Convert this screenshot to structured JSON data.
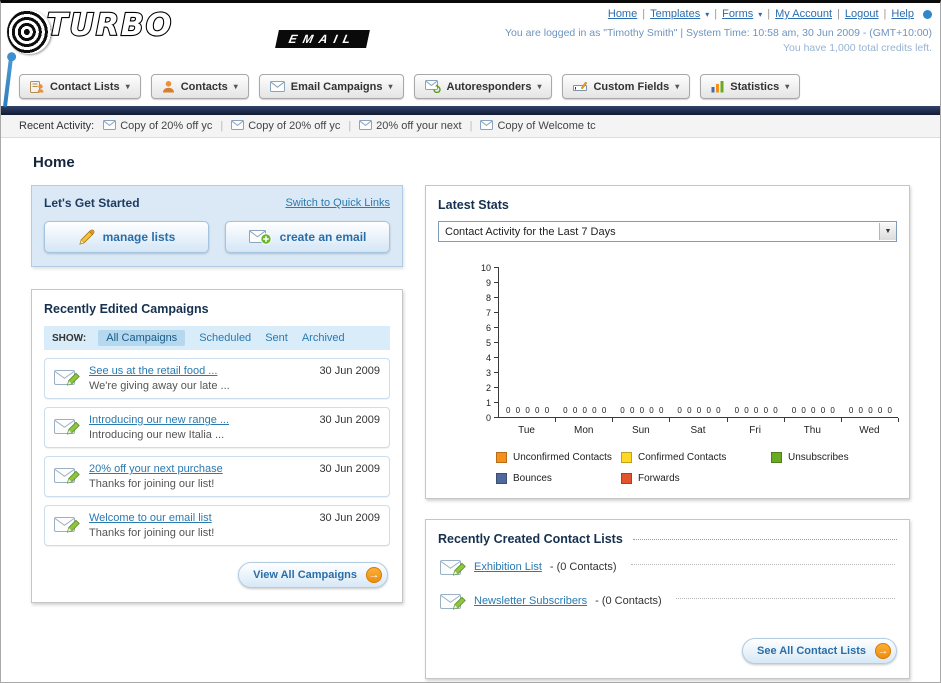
{
  "header": {
    "logo_line1": "TURBO",
    "logo_line2": "EMAIL",
    "links": [
      {
        "label": "Home",
        "dropdown": false
      },
      {
        "label": "Templates",
        "dropdown": true
      },
      {
        "label": "Forms",
        "dropdown": true
      },
      {
        "label": "My Account",
        "dropdown": false
      },
      {
        "label": "Logout",
        "dropdown": false
      },
      {
        "label": "Help",
        "dropdown": false
      }
    ],
    "login_info": "You are logged in as \"Timothy Smith\" | System Time: 10:58 am, 30 Jun 2009 - (GMT+10:00)",
    "credits_info": "You have 1,000 total credits left."
  },
  "nav": {
    "tabs": [
      {
        "label": "Contact Lists",
        "icon": "contact-lists-icon"
      },
      {
        "label": "Contacts",
        "icon": "contacts-icon"
      },
      {
        "label": "Email Campaigns",
        "icon": "email-campaigns-icon"
      },
      {
        "label": "Autoresponders",
        "icon": "autoresponders-icon"
      },
      {
        "label": "Custom Fields",
        "icon": "custom-fields-icon"
      },
      {
        "label": "Statistics",
        "icon": "statistics-icon"
      }
    ]
  },
  "activity": {
    "label": "Recent Activity:",
    "items": [
      "Copy of 20% off yc",
      "Copy of 20% off yc",
      "20% off your next",
      "Copy of Welcome tc"
    ]
  },
  "page_title": "Home",
  "get_started": {
    "title": "Let's Get Started",
    "switch_link": "Switch to Quick Links",
    "manage_lists_btn": "manage lists",
    "create_email_btn": "create an email"
  },
  "campaigns": {
    "title": "Recently Edited Campaigns",
    "show_label": "SHOW:",
    "tabs": [
      {
        "label": "All Campaigns",
        "selected": true
      },
      {
        "label": "Scheduled",
        "selected": false
      },
      {
        "label": "Sent",
        "selected": false
      },
      {
        "label": "Archived",
        "selected": false
      }
    ],
    "rows": [
      {
        "title": "See us at the retail food ...",
        "subtitle": "We're giving away our late ...",
        "date": "30 Jun 2009"
      },
      {
        "title": "Introducing our new range ...",
        "subtitle": "Introducing our new Italia ...",
        "date": "30 Jun 2009"
      },
      {
        "title": "20% off your next purchase",
        "subtitle": "Thanks for joining our list!",
        "date": "30 Jun 2009"
      },
      {
        "title": "Welcome to our email list",
        "subtitle": "Thanks for joining our list!",
        "date": "30 Jun 2009"
      }
    ],
    "view_all_btn": "View All Campaigns"
  },
  "stats": {
    "title": "Latest Stats",
    "filter_value": "Contact Activity for the Last 7 Days",
    "chart_data": {
      "type": "bar",
      "title": "Contact Activity for the Last 7 Days",
      "categories": [
        "Tue",
        "Mon",
        "Sun",
        "Sat",
        "Fri",
        "Thu",
        "Wed"
      ],
      "series": [
        {
          "name": "Unconfirmed Contacts",
          "color": "#f5901f",
          "values": [
            0,
            0,
            0,
            0,
            0,
            0,
            0
          ]
        },
        {
          "name": "Confirmed Contacts",
          "color": "#fed823",
          "values": [
            0,
            0,
            0,
            0,
            0,
            0,
            0
          ]
        },
        {
          "name": "Unsubscribes",
          "color": "#6aaa23",
          "values": [
            0,
            0,
            0,
            0,
            0,
            0,
            0
          ]
        },
        {
          "name": "Bounces",
          "color": "#50699c",
          "values": [
            0,
            0,
            0,
            0,
            0,
            0,
            0
          ]
        },
        {
          "name": "Forwards",
          "color": "#e4542c",
          "values": [
            0,
            0,
            0,
            0,
            0,
            0,
            0
          ]
        }
      ],
      "xlabel": "",
      "ylabel": "",
      "ylim": [
        0,
        10
      ],
      "ytick_step": 1,
      "grid": false,
      "value_labels_shown": true,
      "legend_position": "bottom"
    }
  },
  "contact_lists": {
    "title": "Recently Created Contact Lists",
    "items": [
      {
        "name": "Exhibition List",
        "detail": "- (0 Contacts)"
      },
      {
        "name": "Newsletter Subscribers",
        "detail": "- (0 Contacts)"
      }
    ],
    "see_all_btn": "See All Contact Lists"
  }
}
